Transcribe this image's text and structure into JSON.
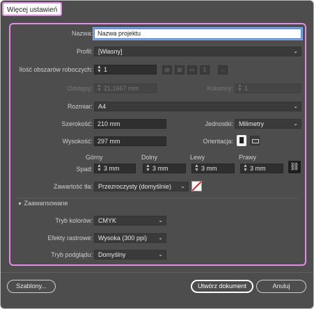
{
  "window": {
    "title": "Więcej ustawień"
  },
  "name": {
    "label": "Nazwa:",
    "value": "Nazwa projektu"
  },
  "profile": {
    "label": "Profil:",
    "value": "[Własny]"
  },
  "artboards": {
    "label": "Ilość obszarów roboczych:",
    "value": "1"
  },
  "spacing": {
    "label": "Odstępy:",
    "value": "21,1667 mm"
  },
  "columns": {
    "label": "Kolumny:",
    "value": "1"
  },
  "size": {
    "label": "Rozmiar:",
    "value": "A4"
  },
  "width": {
    "label": "Szerokość:",
    "value": "210 mm"
  },
  "height": {
    "label": "Wysokość:",
    "value": "297 mm"
  },
  "units": {
    "label": "Jednostki:",
    "value": "Milimetry"
  },
  "orientation": {
    "label": "Orientacja:"
  },
  "bleed": {
    "label": "Spad:",
    "top_label": "Górny",
    "top_value": "3 mm",
    "bottom_label": "Dolny",
    "bottom_value": "3 mm",
    "left_label": "Lewy",
    "left_value": "3 mm",
    "right_label": "Prawy",
    "right_value": "3 mm"
  },
  "background": {
    "label": "Zawartość tła:",
    "value": "Przezroczysty (domyślnie)"
  },
  "advanced": {
    "title": "Zaawansowane",
    "color_mode_label": "Tryb kolorów:",
    "color_mode_value": "CMYK",
    "raster_label": "Efekty rastrowe:",
    "raster_value": "Wysoka (300 ppi)",
    "preview_label": "Tryb podglądu:",
    "preview_value": "Domyślny"
  },
  "buttons": {
    "templates": "Szablony...",
    "create": "Utwórz dokument",
    "cancel": "Anuluj"
  },
  "colors": {
    "highlight": "#e58ce8",
    "dialog_bg": "#4d4d4d",
    "field_bg": "#2f2f2f"
  }
}
